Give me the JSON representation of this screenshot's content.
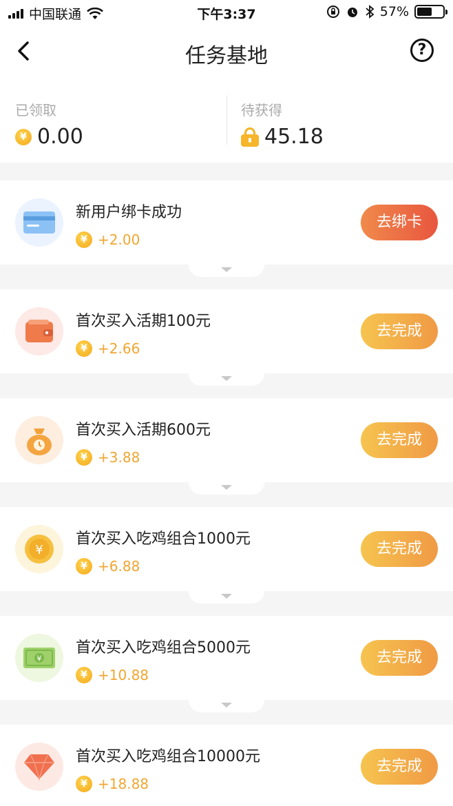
{
  "status_bar": {
    "carrier": "中国联通",
    "time": "下午3:37",
    "battery": "57%"
  },
  "nav": {
    "title": "任务基地",
    "help": "?"
  },
  "summary": {
    "claimed_label": "已领取",
    "claimed_value": "0.00",
    "pending_label": "待获得",
    "pending_value": "45.18"
  },
  "coin_symbol": "¥",
  "tasks": [
    {
      "title": "新用户绑卡成功",
      "reward": "+2.00",
      "button": "去绑卡",
      "icon": "bank-card-icon"
    },
    {
      "title": "首次买入活期100元",
      "reward": "+2.66",
      "button": "去完成",
      "icon": "wallet-icon"
    },
    {
      "title": "首次买入活期600元",
      "reward": "+3.88",
      "button": "去完成",
      "icon": "money-bag-icon"
    },
    {
      "title": "首次买入吃鸡组合1000元",
      "reward": "+6.88",
      "button": "去完成",
      "icon": "coin-icon"
    },
    {
      "title": "首次买入吃鸡组合5000元",
      "reward": "+10.88",
      "button": "去完成",
      "icon": "banknote-icon"
    },
    {
      "title": "首次买入吃鸡组合10000元",
      "reward": "+18.88",
      "button": "去完成",
      "icon": "diamond-icon"
    }
  ]
}
